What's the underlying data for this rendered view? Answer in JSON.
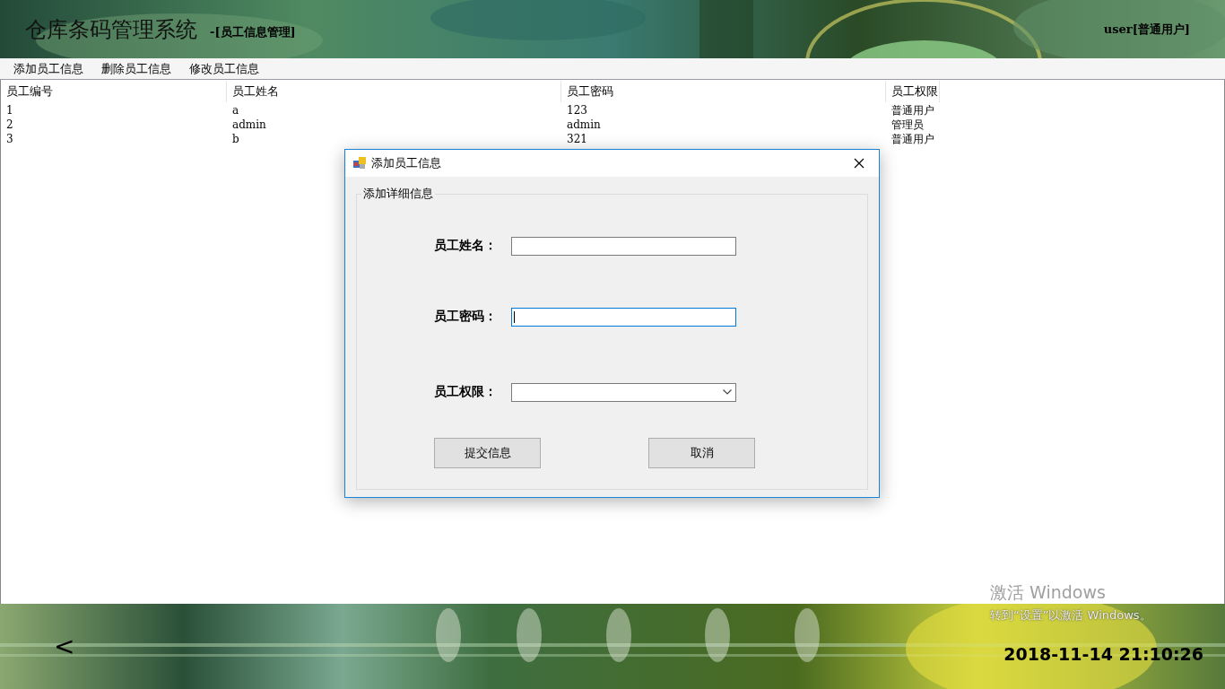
{
  "header": {
    "title": "仓库条码管理系统",
    "subtitle": "-[员工信息管理]",
    "user": "user[普通用户]"
  },
  "menu": [
    "添加员工信息",
    "删除员工信息",
    "修改员工信息"
  ],
  "table": {
    "columns": [
      "员工编号",
      "员工姓名",
      "员工密码",
      "员工权限"
    ],
    "rows": [
      [
        "1",
        "a",
        "123",
        "普通用户"
      ],
      [
        "2",
        "admin",
        "admin",
        "管理员"
      ],
      [
        "3",
        "b",
        "321",
        "普通用户"
      ]
    ]
  },
  "dialog": {
    "title": "添加员工信息",
    "group_label": "添加详细信息",
    "fields": [
      {
        "kind": "text",
        "label": "员工姓名：",
        "focused": false
      },
      {
        "kind": "text",
        "label": "员工密码：",
        "focused": true
      },
      {
        "kind": "select",
        "label": "员工权限：",
        "focused": false
      }
    ],
    "buttons": [
      "提交信息",
      "取消"
    ]
  },
  "footer": {
    "back": "<",
    "datetime": "2018-11-14 21:10:26"
  },
  "activation": {
    "title": "激活 Windows",
    "hint": "转到“设置”以激活 Windows。"
  }
}
